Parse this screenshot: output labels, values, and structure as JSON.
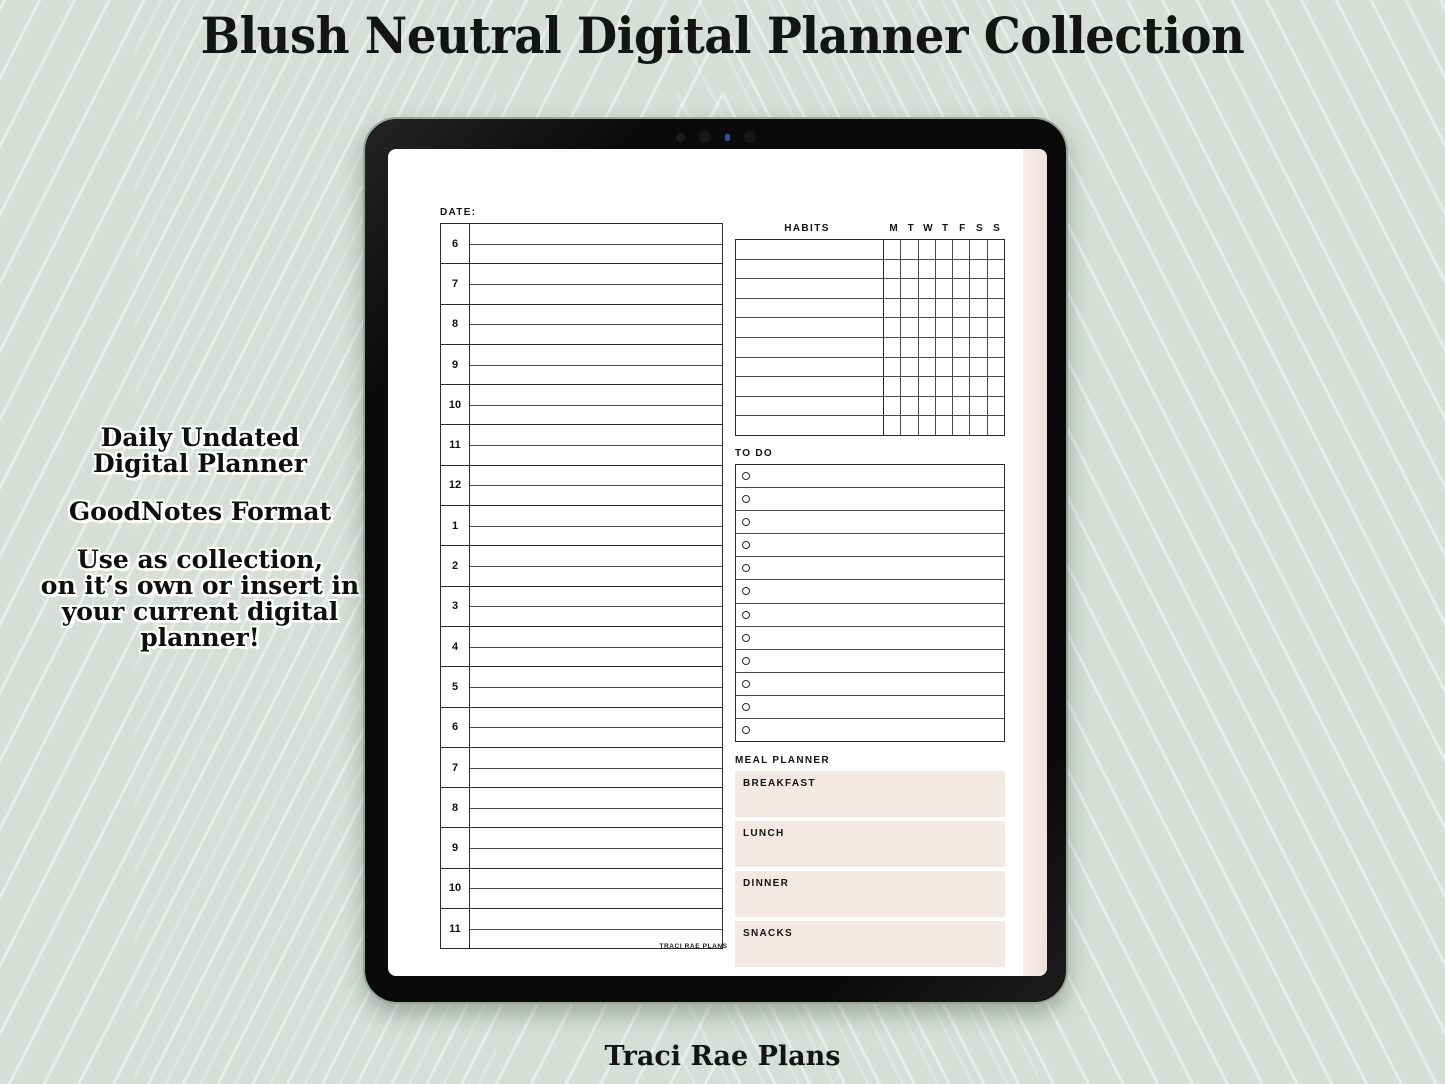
{
  "header": {
    "title": "Blush Neutral Digital Planner Collection"
  },
  "footer": {
    "brand": "Traci Rae Plans"
  },
  "feature_copy": {
    "line_1": "Daily Undated\nDigital Planner",
    "line_2": "GoodNotes Format",
    "line_3": "Use as collection,\non it’s own or insert in\nyour current digital\nplanner!"
  },
  "colors": {
    "background_sage": "#d6ded7",
    "meal_block_blush": "#f4e8e5",
    "page_edge_blush": "#f3e5e1",
    "ink": "#121212",
    "bezel": "#0c0c0c"
  },
  "planner": {
    "date_label": "DATE:",
    "schedule_hours": [
      "6",
      "7",
      "8",
      "9",
      "10",
      "11",
      "12",
      "1",
      "2",
      "3",
      "4",
      "5",
      "6",
      "7",
      "8",
      "9",
      "10",
      "11"
    ],
    "habits": {
      "title": "HABITS",
      "days": [
        "M",
        "T",
        "W",
        "T",
        "F",
        "S",
        "S"
      ],
      "row_count": 10,
      "rows": [
        "",
        "",
        "",
        "",
        "",
        "",
        "",
        "",
        "",
        ""
      ]
    },
    "todo": {
      "title": "TO DO",
      "row_count": 12,
      "rows": [
        "",
        "",
        "",
        "",
        "",
        "",
        "",
        "",
        "",
        "",
        "",
        ""
      ]
    },
    "meal_planner": {
      "title": "MEAL PLANNER",
      "meals": [
        {
          "label": "BREAKFAST",
          "value": ""
        },
        {
          "label": "LUNCH",
          "value": ""
        },
        {
          "label": "DINNER",
          "value": ""
        },
        {
          "label": "SNACKS",
          "value": ""
        }
      ]
    },
    "page_footer": "TRACI RAE PLANS"
  }
}
